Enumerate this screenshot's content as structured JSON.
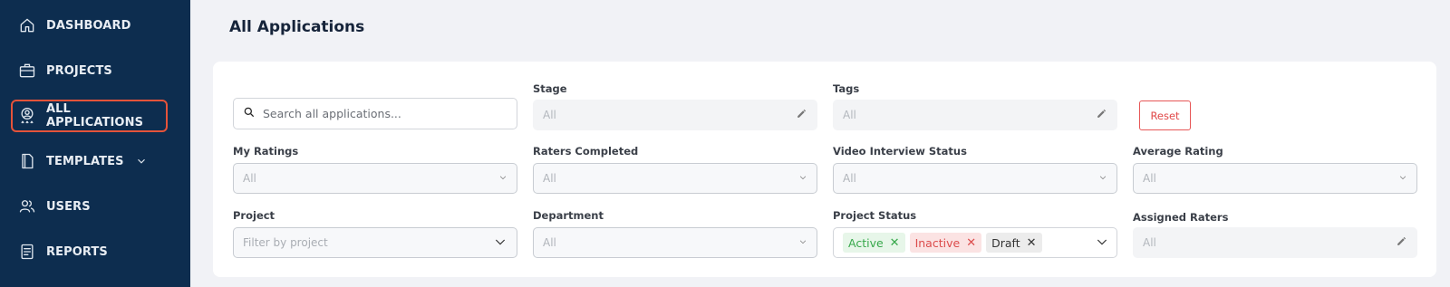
{
  "sidebar": {
    "items": [
      {
        "label": "DASHBOARD",
        "icon": "home-icon"
      },
      {
        "label": "PROJECTS",
        "icon": "briefcase-icon"
      },
      {
        "label": "ALL APPLICATIONS",
        "icon": "applicant-icon",
        "active": true
      },
      {
        "label": "TEMPLATES",
        "icon": "document-icon",
        "has_dropdown": true
      },
      {
        "label": "USERS",
        "icon": "users-icon"
      },
      {
        "label": "REPORTS",
        "icon": "report-icon"
      }
    ]
  },
  "page": {
    "title": "All Applications"
  },
  "filters": {
    "search": {
      "placeholder": "Search all applications..."
    },
    "stage": {
      "label": "Stage",
      "value": "All"
    },
    "tags": {
      "label": "Tags",
      "value": "All"
    },
    "reset_label": "Reset",
    "my_ratings": {
      "label": "My Ratings",
      "value": "All"
    },
    "raters_completed": {
      "label": "Raters Completed",
      "value": "All"
    },
    "video_interview_status": {
      "label": "Video Interview Status",
      "value": "All"
    },
    "average_rating": {
      "label": "Average Rating",
      "value": "All"
    },
    "project": {
      "label": "Project",
      "placeholder": "Filter by project"
    },
    "department": {
      "label": "Department",
      "value": "All"
    },
    "project_status": {
      "label": "Project Status",
      "chips": [
        {
          "label": "Active",
          "color": "#37a84b"
        },
        {
          "label": "Inactive",
          "color": "#dc4c4c"
        },
        {
          "label": "Draft",
          "color": "#333333"
        }
      ]
    },
    "assigned_raters": {
      "label": "Assigned Raters",
      "value": "All"
    }
  },
  "colors": {
    "sidebar_bg": "#0d2d4f",
    "active_outline": "#e5533a",
    "reset": "#e04848"
  }
}
